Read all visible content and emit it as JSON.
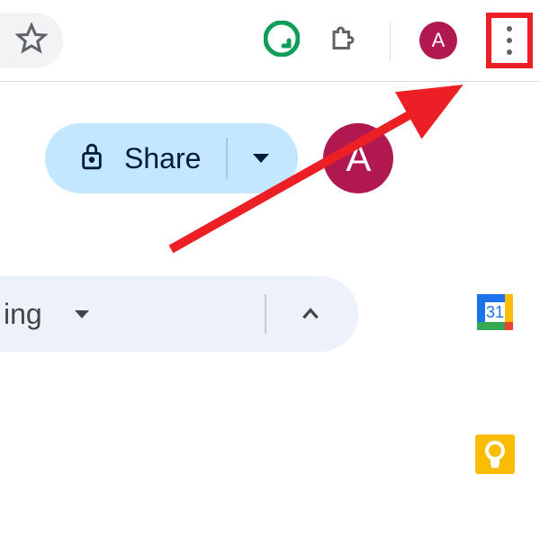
{
  "browser": {
    "avatar_letter": "A"
  },
  "docs": {
    "share_label": "Share",
    "avatar_letter": "A",
    "editing_label_partial": "ing",
    "calendar_day": "31"
  },
  "annotation": {
    "highlight": "chrome-menu-button"
  }
}
